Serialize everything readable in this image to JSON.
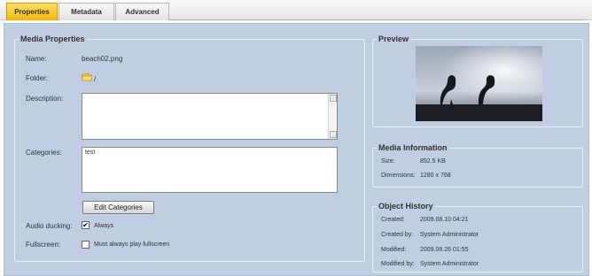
{
  "tabs": [
    {
      "label": "Properties",
      "active": true
    },
    {
      "label": "Metadata",
      "active": false
    },
    {
      "label": "Advanced",
      "active": false
    }
  ],
  "media_properties": {
    "legend": "Media Properties",
    "name_label": "Name:",
    "name_value": "beach02.png",
    "folder_label": "Folder:",
    "folder_value": "/",
    "description_label": "Description:",
    "description_value": "",
    "categories_label": "Categories:",
    "categories_value": "test",
    "edit_categories_label": "Edit Categories",
    "audio_ducking_label": "Audio ducking:",
    "audio_ducking_option": "Always",
    "audio_ducking_checked": true,
    "fullscreen_label": "Fullscreen:",
    "fullscreen_option": "Must always play fullscreen",
    "fullscreen_checked": false
  },
  "preview": {
    "legend": "Preview"
  },
  "media_information": {
    "legend": "Media Information",
    "size_label": "Size:",
    "size_value": "852.5 KB",
    "dimensions_label": "Dimensions:",
    "dimensions_value": "1280 x 768"
  },
  "object_history": {
    "legend": "Object History",
    "created_label": "Created:",
    "created_value": "2009.08.10 04:21",
    "created_by_label": "Created by:",
    "created_by_value": "System Administrator",
    "modified_label": "Modified:",
    "modified_value": "2009.08.26 01:55",
    "modified_by_label": "Modified by:",
    "modified_by_value": "System Administrator"
  },
  "colors": {
    "panel_bg": "#bfcfe1",
    "active_tab": "#f5b800",
    "fieldset_border": "#e8eef6"
  }
}
